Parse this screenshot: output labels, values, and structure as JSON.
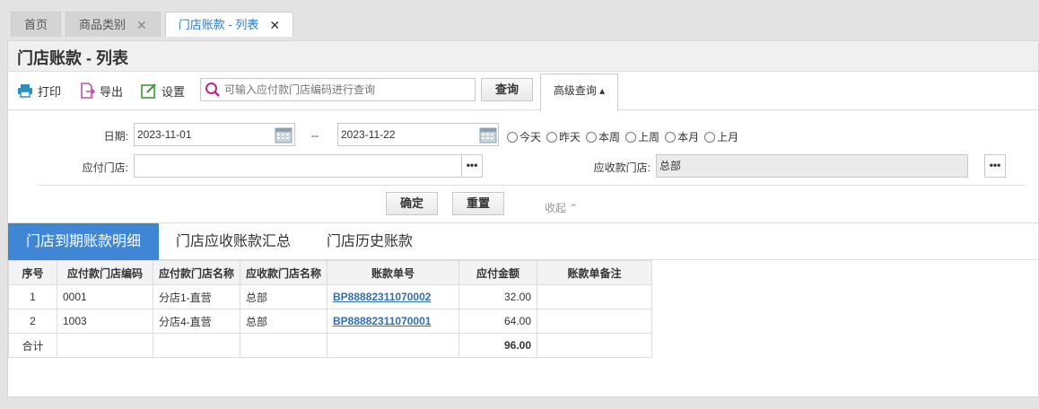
{
  "top_tabs": [
    {
      "label": "首页",
      "closable": false
    },
    {
      "label": "商品类别",
      "closable": true
    },
    {
      "label": "门店账款 - 列表",
      "closable": true,
      "active": true
    }
  ],
  "page_title": "门店账款 - 列表",
  "toolbar": {
    "print_label": "打印",
    "export_label": "导出",
    "settings_label": "设置",
    "search_placeholder": "可输入应付款门店编码进行查询",
    "query_label": "查询",
    "advanced_label": "高级查询 ▴"
  },
  "filters": {
    "date_label": "日期:",
    "date_from": "2023-11-01",
    "date_sep": "--",
    "date_to": "2023-11-22",
    "quick_ranges": [
      "今天",
      "昨天",
      "本周",
      "上周",
      "本月",
      "上月"
    ],
    "pay_store_label": "应付门店:",
    "pay_store_value": "",
    "recv_store_label": "应收款门店:",
    "recv_store_value": "总部",
    "confirm_label": "确定",
    "reset_label": "重置",
    "collapse_label": "收起 ⌃"
  },
  "content_tabs": [
    "门店到期账款明细",
    "门店应收账款汇总",
    "门店历史账款"
  ],
  "table": {
    "headers": [
      "序号",
      "应付款门店编码",
      "应付款门店名称",
      "应收款门店名称",
      "账款单号",
      "应付金额",
      "账款单备注"
    ],
    "rows": [
      [
        "1",
        "0001",
        "分店1-直营",
        "总部",
        "BP88882311070002",
        "32.00",
        ""
      ],
      [
        "2",
        "1003",
        "分店4-直营",
        "总部",
        "BP88882311070001",
        "64.00",
        ""
      ]
    ],
    "total": {
      "label": "合计",
      "amount": "96.00"
    }
  },
  "colors": {
    "accent": "#3f86d4",
    "link": "#2f6fb5",
    "print_icon": "#2b8fc4",
    "export_icon": "#c84bb5",
    "settings_icon": "#3a9a3a",
    "search_icon": "#c0277f"
  }
}
